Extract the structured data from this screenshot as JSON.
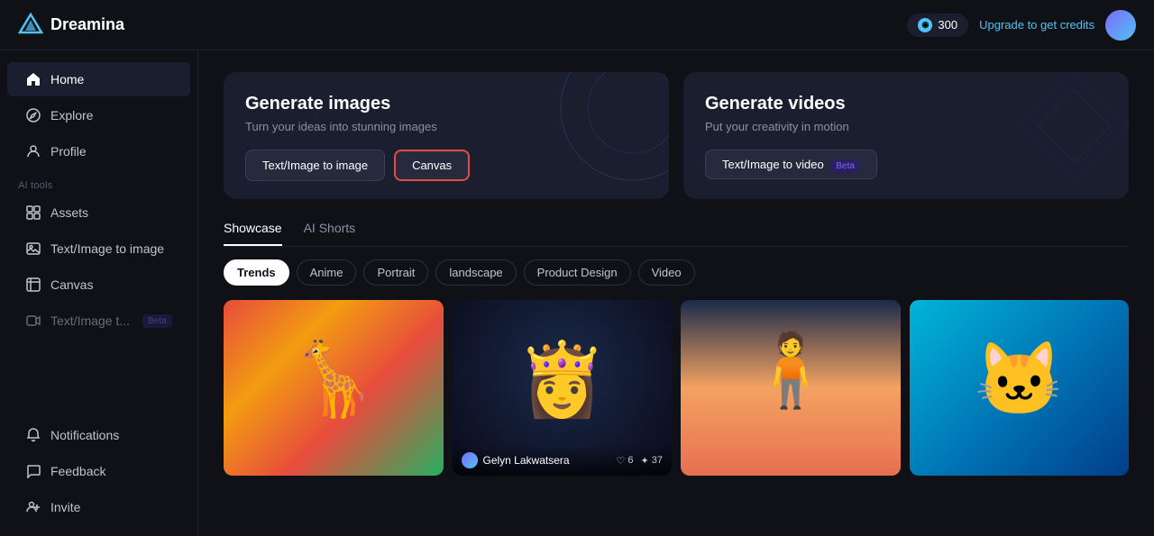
{
  "topnav": {
    "logo_text": "Dreamina",
    "credits_count": "300",
    "upgrade_label": "Upgrade to get credits"
  },
  "sidebar": {
    "nav_items": [
      {
        "id": "home",
        "label": "Home",
        "icon": "home-icon",
        "active": true
      },
      {
        "id": "explore",
        "label": "Explore",
        "icon": "compass-icon",
        "active": false
      },
      {
        "id": "profile",
        "label": "Profile",
        "icon": "user-icon",
        "active": false
      }
    ],
    "section_label": "AI tools",
    "tool_items": [
      {
        "id": "assets",
        "label": "Assets",
        "icon": "grid-icon",
        "active": false
      },
      {
        "id": "text-image",
        "label": "Text/Image to image",
        "icon": "image-icon",
        "active": false
      },
      {
        "id": "canvas",
        "label": "Canvas",
        "icon": "canvas-icon",
        "active": false
      },
      {
        "id": "text-video",
        "label": "Text/Image t...",
        "icon": "video-icon",
        "beta": true,
        "active": false,
        "disabled": true
      }
    ],
    "bottom_items": [
      {
        "id": "notifications",
        "label": "Notifications",
        "icon": "bell-icon"
      },
      {
        "id": "feedback",
        "label": "Feedback",
        "icon": "feedback-icon"
      },
      {
        "id": "invite",
        "label": "Invite",
        "icon": "invite-icon"
      }
    ]
  },
  "generate_images_card": {
    "title": "Generate images",
    "subtitle": "Turn your ideas into stunning images",
    "btn1_label": "Text/Image to image",
    "btn2_label": "Canvas"
  },
  "generate_videos_card": {
    "title": "Generate videos",
    "subtitle": "Put your creativity in motion",
    "btn1_label": "Text/Image to video",
    "beta_label": "Beta"
  },
  "showcase": {
    "tabs": [
      {
        "id": "showcase",
        "label": "Showcase",
        "active": true
      },
      {
        "id": "ai-shorts",
        "label": "AI Shorts",
        "active": false
      }
    ],
    "filter_pills": [
      {
        "id": "trends",
        "label": "Trends",
        "active": true
      },
      {
        "id": "anime",
        "label": "Anime",
        "active": false
      },
      {
        "id": "portrait",
        "label": "Portrait",
        "active": false
      },
      {
        "id": "landscape",
        "label": "landscape",
        "active": false
      },
      {
        "id": "product-design",
        "label": "Product Design",
        "active": false
      },
      {
        "id": "video",
        "label": "Video",
        "active": false
      }
    ],
    "images": [
      {
        "id": "img1",
        "type": "giraffe",
        "user": "",
        "likes": "",
        "stars": ""
      },
      {
        "id": "img2",
        "type": "lady",
        "user": "Gelyn Lakwatsera",
        "likes": "6",
        "stars": "37"
      },
      {
        "id": "img3",
        "type": "woman",
        "user": "",
        "likes": "",
        "stars": ""
      },
      {
        "id": "img4",
        "type": "cat",
        "user": "",
        "likes": "",
        "stars": ""
      }
    ]
  }
}
